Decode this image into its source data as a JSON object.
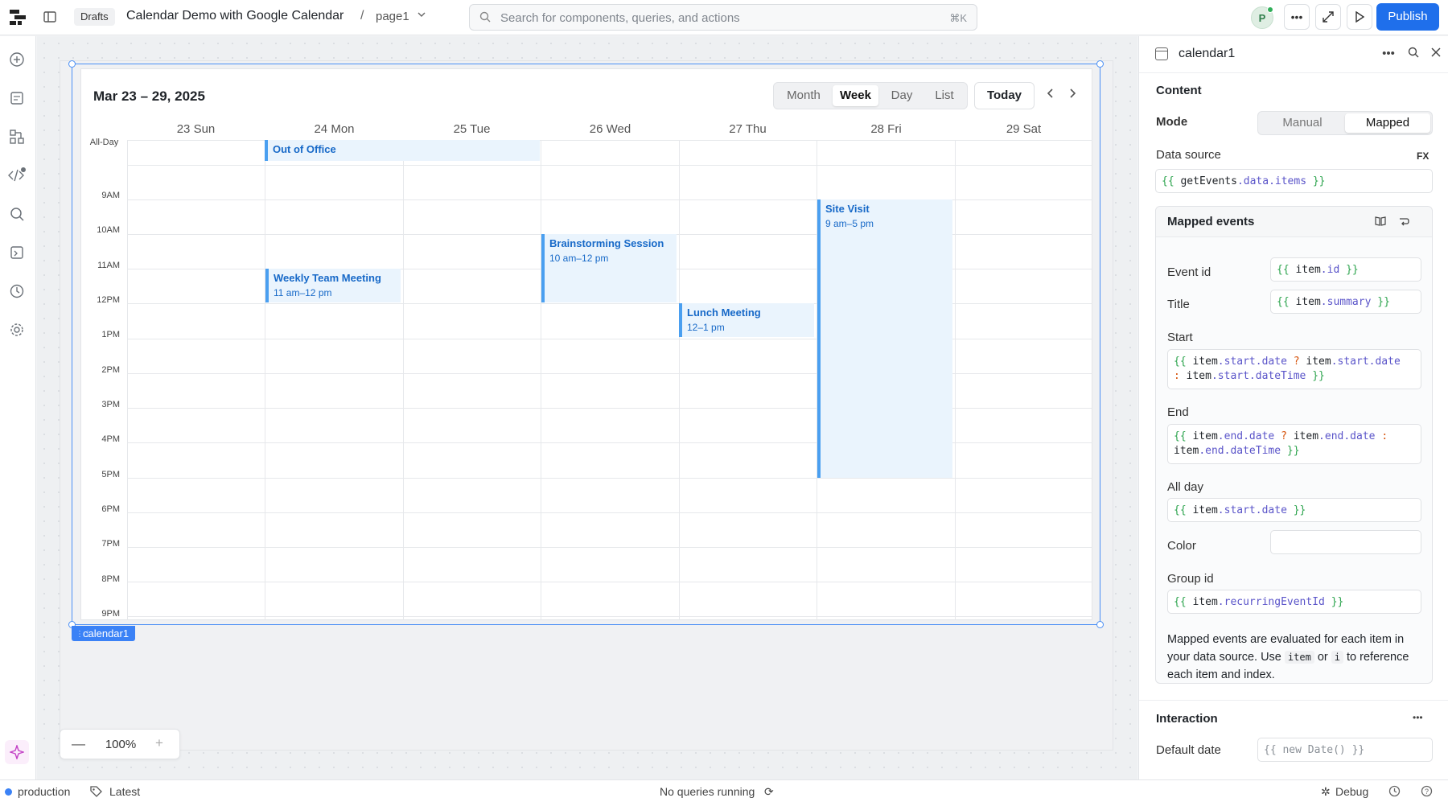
{
  "topbar": {
    "drafts_label": "Drafts",
    "app_title": "Calendar Demo with Google Calendar",
    "breadcrumb_sep": "/",
    "page_name": "page1",
    "search_placeholder": "Search for components, queries, and actions",
    "search_shortcut": "⌘K",
    "avatar_initial": "P",
    "publish_label": "Publish"
  },
  "calendar": {
    "title": "Mar 23 – 29, 2025",
    "views": [
      "Month",
      "Week",
      "Day",
      "List"
    ],
    "active_view": "Week",
    "today_label": "Today",
    "days": [
      "23 Sun",
      "24 Mon",
      "25 Tue",
      "26 Wed",
      "27 Thu",
      "28 Fri",
      "29 Sat"
    ],
    "allday_label": "All-Day",
    "hours": [
      "9AM",
      "10AM",
      "11AM",
      "12PM",
      "1PM",
      "2PM",
      "3PM",
      "4PM",
      "5PM",
      "6PM",
      "7PM",
      "8PM",
      "9PM"
    ],
    "allday_event": {
      "title": "Out of Office"
    },
    "events": [
      {
        "title": "Weekly Team Meeting",
        "time": "11 am–12 pm"
      },
      {
        "title": "Brainstorming Session",
        "time": "10 am–12 pm"
      },
      {
        "title": "Lunch Meeting",
        "time": "12–1 pm"
      },
      {
        "title": "Site Visit",
        "time": "9 am–5 pm"
      }
    ],
    "accent": "#4a9ff0"
  },
  "canvas": {
    "component_tag": "calendar1",
    "zoom": "100%"
  },
  "inspector": {
    "component_name": "calendar1",
    "content_title": "Content",
    "mode_label": "Mode",
    "mode_options": [
      "Manual",
      "Mapped"
    ],
    "mode_selected": "Mapped",
    "data_source_label": "Data source",
    "fx_label": "FX",
    "mapped_events_title": "Mapped events",
    "fields": {
      "event_id": {
        "label": "Event id"
      },
      "title": {
        "label": "Title"
      },
      "start": {
        "label": "Start"
      },
      "end": {
        "label": "End"
      },
      "all_day": {
        "label": "All day"
      },
      "color": {
        "label": "Color",
        "value": ""
      },
      "group_id": {
        "label": "Group id"
      }
    },
    "help_prefix": "Mapped events are evaluated for each item in your data source. Use",
    "help_code1": "item",
    "help_or": "or",
    "help_code2": "i",
    "help_suffix": "to reference each item and index.",
    "interaction_title": "Interaction",
    "default_date_label": "Default date",
    "default_date_placeholder": "{{ new Date() }}"
  },
  "statusbar": {
    "environment": "production",
    "version": "Latest",
    "queries": "No queries running",
    "debug": "Debug"
  },
  "icons": [
    "logo",
    "sidebar-toggle-icon",
    "search-icon",
    "more-icon",
    "expand-icon",
    "play-icon",
    "add-icon",
    "page-icon",
    "components-icon",
    "code-icon",
    "rail-search-icon",
    "state-icon",
    "history-icon",
    "settings-icon",
    "sparkle-icon",
    "calendar-icon",
    "book-icon",
    "wrap-icon",
    "sync-icon",
    "tag-icon",
    "help-icon"
  ]
}
